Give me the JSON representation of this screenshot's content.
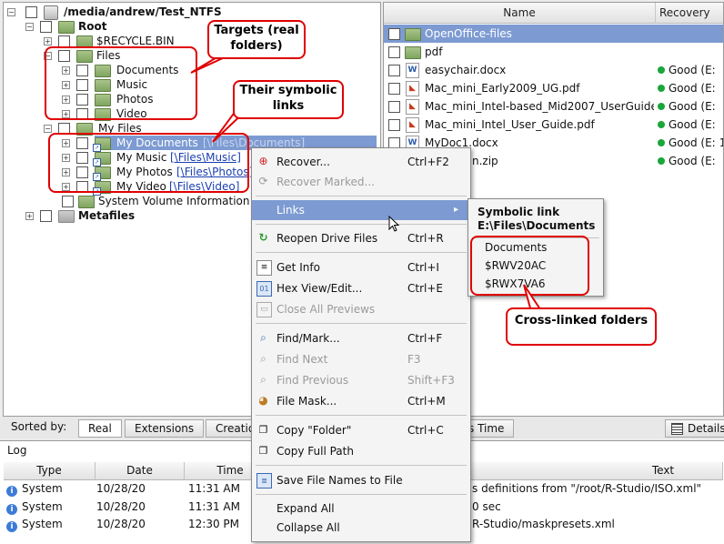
{
  "tree": {
    "root_path": "/media/andrew/Test_NTFS",
    "items": [
      {
        "label": "Root"
      },
      {
        "label": "$RECYCLE.BIN"
      },
      {
        "label": "Files"
      },
      {
        "label": "Documents"
      },
      {
        "label": "Music"
      },
      {
        "label": "Photos"
      },
      {
        "label": "Video"
      },
      {
        "label": "My Files"
      },
      {
        "label": "My Documents",
        "link": "[\\Files\\Documents]"
      },
      {
        "label": "My Music",
        "link": "[\\Files\\Music]"
      },
      {
        "label": "My Photos",
        "link": "[\\Files\\Photos]"
      },
      {
        "label": "My Video",
        "link": "[\\Files\\Video]"
      },
      {
        "label": "System Volume Information"
      },
      {
        "label": "Metafiles"
      }
    ]
  },
  "file_list": {
    "columns": [
      "Name",
      "Recovery"
    ],
    "rows": [
      {
        "name": "OpenOffice-files",
        "recovery": "",
        "icon": "folder-icon"
      },
      {
        "name": "pdf",
        "recovery": "",
        "icon": "folder-icon"
      },
      {
        "name": "easychair.docx",
        "recovery": "Good (E:",
        "icon": "docx-icon"
      },
      {
        "name": "Mac_mini_Early2009_UG.pdf",
        "recovery": "Good (E:",
        "icon": "pdf-icon"
      },
      {
        "name": "Mac_mini_Intel-based_Mid2007_UserGuide",
        "recovery": "Good (E:",
        "icon": "pdf-icon"
      },
      {
        "name": "Mac_mini_Intel_User_Guide.pdf",
        "recovery": "Good (E:",
        "icon": "pdf-icon"
      },
      {
        "name": "MyDoc1.docx",
        "recovery": "Good (E:",
        "extra": "1",
        "icon": "docx-icon"
      },
      {
        "name": "n.zip",
        "recovery": "Good (E:",
        "icon": "zip-icon"
      }
    ]
  },
  "context_menu": {
    "items": [
      {
        "label": "Recover...",
        "shortcut": "Ctrl+F2",
        "icon": "recover-icon"
      },
      {
        "label": "Recover Marked...",
        "shortcut": "",
        "icon": "recover-marked-icon"
      },
      {
        "label": "Links",
        "shortcut": "",
        "icon": ""
      },
      {
        "label": "Reopen Drive Files",
        "shortcut": "Ctrl+R",
        "icon": "refresh-icon"
      },
      {
        "label": "Get Info",
        "shortcut": "Ctrl+I",
        "icon": "info-icon"
      },
      {
        "label": "Hex View/Edit...",
        "shortcut": "Ctrl+E",
        "icon": "hex-icon"
      },
      {
        "label": "Close All Previews",
        "shortcut": "",
        "icon": "close-previews-icon"
      },
      {
        "label": "Find/Mark...",
        "shortcut": "Ctrl+F",
        "icon": "find-icon"
      },
      {
        "label": "Find Next",
        "shortcut": "F3",
        "icon": "find-next-icon"
      },
      {
        "label": "Find Previous",
        "shortcut": "Shift+F3",
        "icon": "find-previous-icon"
      },
      {
        "label": "File Mask...",
        "shortcut": "Ctrl+M",
        "icon": "mask-icon"
      },
      {
        "label": "Copy \"Folder\"",
        "shortcut": "Ctrl+C",
        "icon": "copy-icon"
      },
      {
        "label": "Copy Full Path",
        "shortcut": "",
        "icon": "copy-path-icon"
      },
      {
        "label": "Save File Names to File",
        "shortcut": "",
        "icon": "save-names-icon"
      },
      {
        "label": "Expand All",
        "shortcut": "",
        "icon": ""
      },
      {
        "label": "Collapse All",
        "shortcut": "",
        "icon": ""
      }
    ]
  },
  "links_submenu": {
    "header_line1": "Symbolic link",
    "header_line2": "E:\\Files\\Documents",
    "items": [
      "Documents",
      "$RWV20AC",
      "$RWX7VA6"
    ]
  },
  "callouts": {
    "targets": "Targets (real folders)",
    "symlinks": "Their symbolic links",
    "crosslinked": "Cross-linked folders"
  },
  "sort_bar": {
    "label": "Sorted by:",
    "tabs": [
      "Real",
      "Extensions",
      "Creation",
      "s Time"
    ],
    "details": "Details"
  },
  "log": {
    "title": "Log",
    "columns": [
      "Type",
      "Date",
      "Time",
      "Text"
    ],
    "rows": [
      {
        "type": "System",
        "date": "10/28/20",
        "time": "11:31 AM",
        "text": "s definitions from \"/root/R-Studio/ISO.xml\""
      },
      {
        "type": "System",
        "date": "10/28/20",
        "time": "11:31 AM",
        "text": "0 sec"
      },
      {
        "type": "System",
        "date": "10/28/20",
        "time": "12:30 PM",
        "text": "R-Studio/maskpresets.xml"
      }
    ]
  },
  "colors": {
    "selection": "#7d9bd2",
    "callout_border": "#e00000",
    "good": "#1aa63a"
  }
}
